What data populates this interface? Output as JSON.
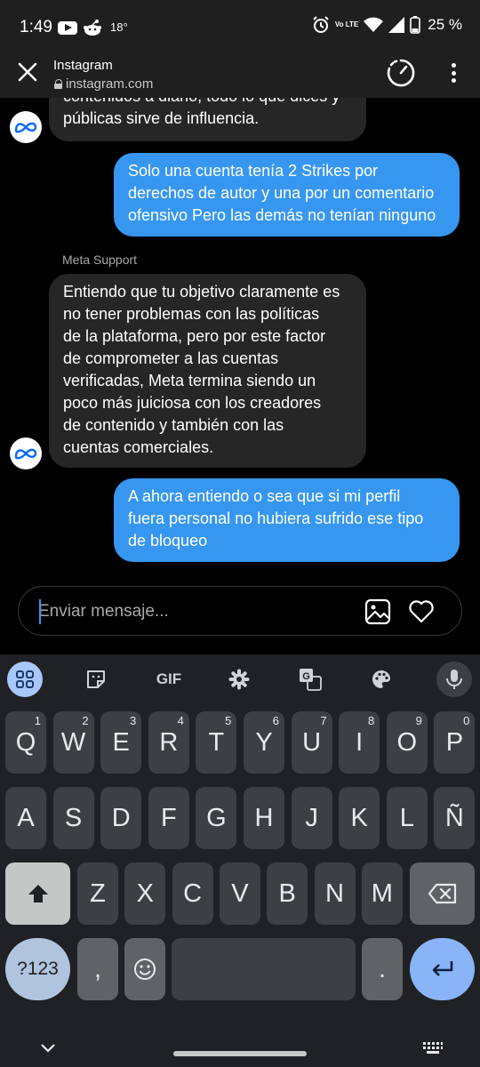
{
  "status_bar": {
    "time": "1:49",
    "temperature": "18°",
    "network": "Vo LTE",
    "battery": "25 %"
  },
  "browser": {
    "title": "Instagram",
    "url": "instagram.com"
  },
  "chat": {
    "messages": [
      {
        "from": "meta",
        "lines": [
          "contenidos a diario, todo lo que dices y",
          "públicas sirve de influencia."
        ]
      },
      {
        "from": "me",
        "lines": [
          "Solo una cuenta tenía 2 Strikes por",
          "derechos de autor y una por un comentario",
          "ofensivo Pero las demás no tenían ninguno"
        ]
      },
      {
        "from": "meta",
        "sender": "Meta Support",
        "lines": [
          "Entiendo que tu objetivo claramente es",
          "no tener problemas con las políticas",
          "de la plataforma, pero por este factor",
          "de comprometer a las cuentas",
          "verificadas, Meta termina siendo un",
          "poco más juiciosa con los creadores",
          "de contenido y también con las",
          "cuentas comerciales."
        ]
      },
      {
        "from": "me",
        "lines": [
          "A ahora entiendo o sea que si mi perfil",
          "fuera personal no hubiera sufrido ese tipo",
          "de bloqueo"
        ]
      }
    ]
  },
  "composer": {
    "placeholder": "Enviar mensaje..."
  },
  "keyboard": {
    "toolbar": {
      "gif_label": "GIF"
    },
    "row1": [
      {
        "key": "Q",
        "hint": "1"
      },
      {
        "key": "W",
        "hint": "2"
      },
      {
        "key": "E",
        "hint": "3"
      },
      {
        "key": "R",
        "hint": "4"
      },
      {
        "key": "T",
        "hint": "5"
      },
      {
        "key": "Y",
        "hint": "6"
      },
      {
        "key": "U",
        "hint": "7"
      },
      {
        "key": "I",
        "hint": "8"
      },
      {
        "key": "O",
        "hint": "9"
      },
      {
        "key": "P",
        "hint": "0"
      }
    ],
    "row2": [
      "A",
      "S",
      "D",
      "F",
      "G",
      "H",
      "J",
      "K",
      "L",
      "Ñ"
    ],
    "row3": [
      "Z",
      "X",
      "C",
      "V",
      "B",
      "N",
      "M"
    ],
    "symbols_label": "?123",
    "comma_label": ",",
    "period_label": "."
  }
}
